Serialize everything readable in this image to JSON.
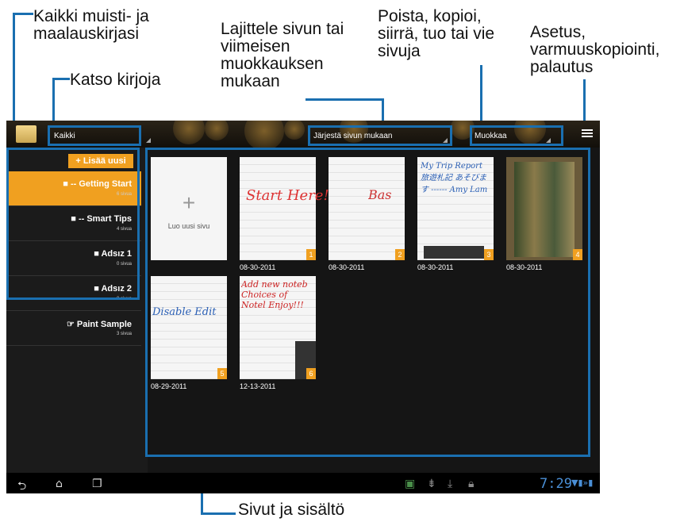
{
  "callouts": {
    "all_books": "Kaikki muisti- ja maalauskirjasi",
    "view_books": "Katso kirjoja",
    "sort": "Lajittele sivun tai viimeisen muokkauksen mukaan",
    "edit": "Poista, kopioi, siirrä, tuo tai vie sivuja",
    "settings": "Asetus, varmuuskopiointi, palautus",
    "pages": "Sivut ja sisältö"
  },
  "topbar": {
    "filter": "Kaikki",
    "sort": "Järjestä sivun mukaan",
    "edit": "Muokkaa"
  },
  "sidebar": {
    "add_new": "+ Lisää uusi",
    "books": [
      {
        "name": "■ -- Getting Start",
        "pages": "6 sivua",
        "selected": true
      },
      {
        "name": "■ -- Smart Tips",
        "pages": "4 sivua"
      },
      {
        "name": "■ Adsız 1",
        "pages": "0 sivua"
      },
      {
        "name": "■ Adsız 2",
        "pages": "0 sivua"
      },
      {
        "name": "☞ Paint Sample",
        "pages": "3 sivua"
      }
    ]
  },
  "grid": {
    "new_page": "Luo uusi sivu",
    "plus": "+",
    "pages": [
      {
        "num": "1",
        "date": "08-30-2011",
        "text": "Start Here!"
      },
      {
        "num": "2",
        "date": "08-30-2011",
        "text": "Bas"
      },
      {
        "num": "3",
        "date": "08-30-2011",
        "text": "My Trip Report 旅遊札記 あそびます ------ Amy Lam"
      },
      {
        "num": "4",
        "date": "08-30-2011",
        "text": ""
      },
      {
        "num": "5",
        "date": "08-29-2011",
        "text": "Disable Edit"
      },
      {
        "num": "6",
        "date": "12-13-2011",
        "text": "Add new noteb Choices of Notel Enjoy!!!"
      }
    ]
  },
  "statusbar": {
    "clock": "7:29",
    "back_icon": "back-icon",
    "home_icon": "home-icon",
    "recent_icon": "recent-apps-icon"
  },
  "colors": {
    "accent": "#f0a020",
    "callout": "#1a6fb0",
    "clock": "#4a8fd6"
  }
}
